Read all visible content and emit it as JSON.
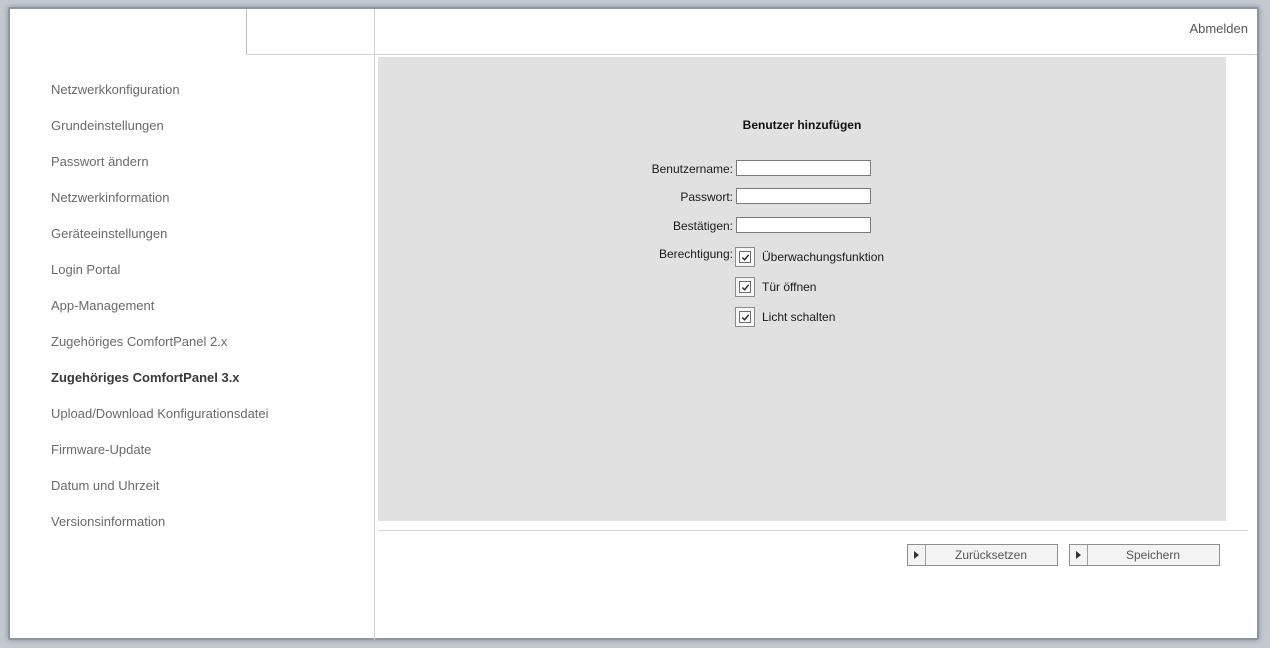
{
  "header": {
    "logout_label": "Abmelden"
  },
  "sidebar": {
    "items": [
      {
        "label": "Netzwerkkonfiguration",
        "active": false
      },
      {
        "label": "Grundeinstellungen",
        "active": false
      },
      {
        "label": "Passwort ändern",
        "active": false
      },
      {
        "label": "Netzwerkinformation",
        "active": false
      },
      {
        "label": "Geräteeinstellungen",
        "active": false
      },
      {
        "label": "Login Portal",
        "active": false
      },
      {
        "label": "App-Management",
        "active": false
      },
      {
        "label": "Zugehöriges ComfortPanel 2.x",
        "active": false
      },
      {
        "label": "Zugehöriges ComfortPanel 3.x",
        "active": true
      },
      {
        "label": "Upload/Download Konfigurationsdatei",
        "active": false
      },
      {
        "label": "Firmware-Update",
        "active": false
      },
      {
        "label": "Datum und Uhrzeit",
        "active": false
      },
      {
        "label": "Versionsinformation",
        "active": false
      }
    ]
  },
  "form": {
    "title": "Benutzer hinzufügen",
    "username": {
      "label": "Benutzername:",
      "value": ""
    },
    "password": {
      "label": "Passwort:",
      "value": ""
    },
    "confirm": {
      "label": "Bestätigen:",
      "value": ""
    },
    "permission_label": "Berechtigung:",
    "permissions": [
      {
        "label": "Überwachungsfunktion",
        "checked": true
      },
      {
        "label": "Tür öffnen",
        "checked": true
      },
      {
        "label": "Licht schalten",
        "checked": true
      }
    ]
  },
  "actions": {
    "reset_label": "Zurücksetzen",
    "save_label": "Speichern"
  },
  "icons": {
    "button_arrow": "play-arrow-icon",
    "checkbox_mark": "check-icon"
  }
}
